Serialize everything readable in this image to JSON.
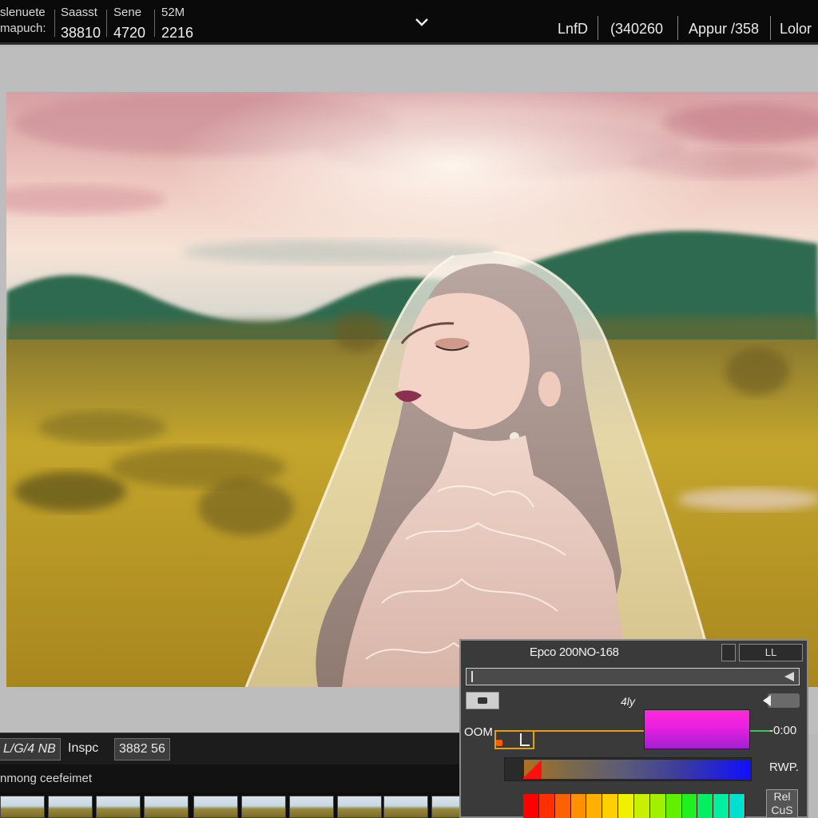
{
  "topbar": {
    "meta": [
      {
        "key": "slenuete\nmapuch:",
        "value": ""
      },
      {
        "key": "Saasst",
        "value": "38810"
      },
      {
        "key": "Sene",
        "value": "4720"
      },
      {
        "key": "52M",
        "value": "2216"
      }
    ],
    "meta_lines": [
      "slenuete",
      "mapuch:"
    ],
    "chevron_icon": "chevron-down-icon",
    "items": [
      "LnfD",
      "(340260",
      "Appur /358",
      "Lolor"
    ]
  },
  "infobar": {
    "chip1": "L/G/4 NB",
    "label": "Inspc",
    "chip2": "3882 56"
  },
  "statusbar": {
    "text": "nmong ceefeimet"
  },
  "panel": {
    "title": "Epco 200NO-168",
    "btn_b": "LL",
    "mid_label": "4ly",
    "oom_label": "OOM",
    "value_label": "-0:00",
    "rwp_label": "RWP.",
    "rel_label": "Rel\nCus",
    "rel_lines": [
      "Rel",
      "CuS"
    ],
    "swatch_color": "#e820e0",
    "palette_colors": [
      "#ff0000",
      "#ff3000",
      "#ff6000",
      "#ff9000",
      "#ffb000",
      "#ffd000",
      "#f0f000",
      "#c8f000",
      "#a0f000",
      "#60f000",
      "#20f020",
      "#00f060",
      "#00f0a0",
      "#00e0d0"
    ]
  },
  "photo": {
    "subject": "bride-with-veil",
    "colors": {
      "sky_top": "#d9a4a6",
      "sky_mid": "#f3d9cf",
      "hills": "#2e6a4e",
      "field": "#b89a28",
      "veil": "#f3ecde"
    }
  }
}
